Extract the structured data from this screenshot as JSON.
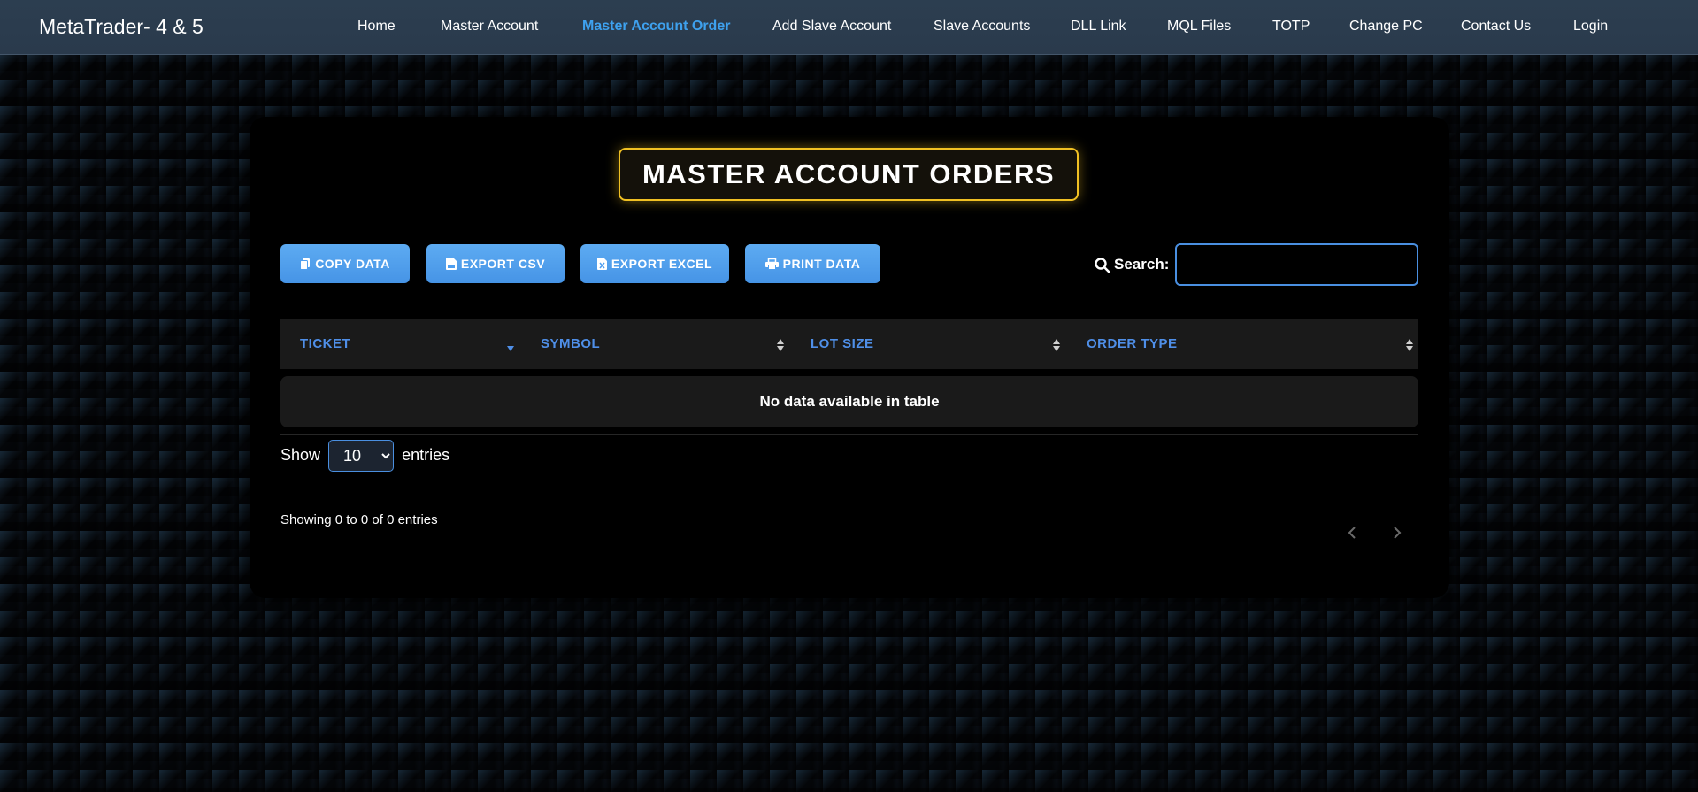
{
  "brand": "MetaTrader- 4 & 5",
  "nav": [
    {
      "label": "Home",
      "active": false
    },
    {
      "label": "Master Account",
      "active": false
    },
    {
      "label": "Master Account Order",
      "active": true
    },
    {
      "label": "Add Slave Account",
      "active": false
    },
    {
      "label": "Slave Accounts",
      "active": false
    },
    {
      "label": "DLL Link",
      "active": false
    },
    {
      "label": "MQL Files",
      "active": false
    },
    {
      "label": "TOTP",
      "active": false
    },
    {
      "label": "Change PC",
      "active": false
    },
    {
      "label": "Contact Us",
      "active": false
    },
    {
      "label": "Login",
      "active": false
    }
  ],
  "page_title": "MASTER ACCOUNT ORDERS",
  "toolbar": {
    "copy_label": "COPY DATA",
    "csv_label": "EXPORT CSV",
    "excel_label": "EXPORT EXCEL",
    "print_label": "PRINT DATA"
  },
  "search": {
    "label": "Search:",
    "value": ""
  },
  "table": {
    "columns": [
      "TICKET",
      "SYMBOL",
      "LOT SIZE",
      "ORDER TYPE"
    ],
    "sorted_column": "TICKET",
    "sort_direction": "desc",
    "empty_message": "No data available in table"
  },
  "length": {
    "show_label": "Show",
    "selected": "10",
    "entries_label": "entries"
  },
  "info": "Showing 0 to 0 of 0 entries",
  "icons": {
    "copy": "copy-icon",
    "csv": "file-csv-icon",
    "excel": "file-excel-icon",
    "print": "print-icon",
    "search": "search-icon",
    "prev": "chevron-left-icon",
    "next": "chevron-right-icon"
  },
  "colors": {
    "nav_bg": "#2c3e50",
    "active_link": "#3ea1ee",
    "title_border": "#f0c023",
    "button": "#4f9ff0",
    "column_header": "#4f8fe8"
  }
}
